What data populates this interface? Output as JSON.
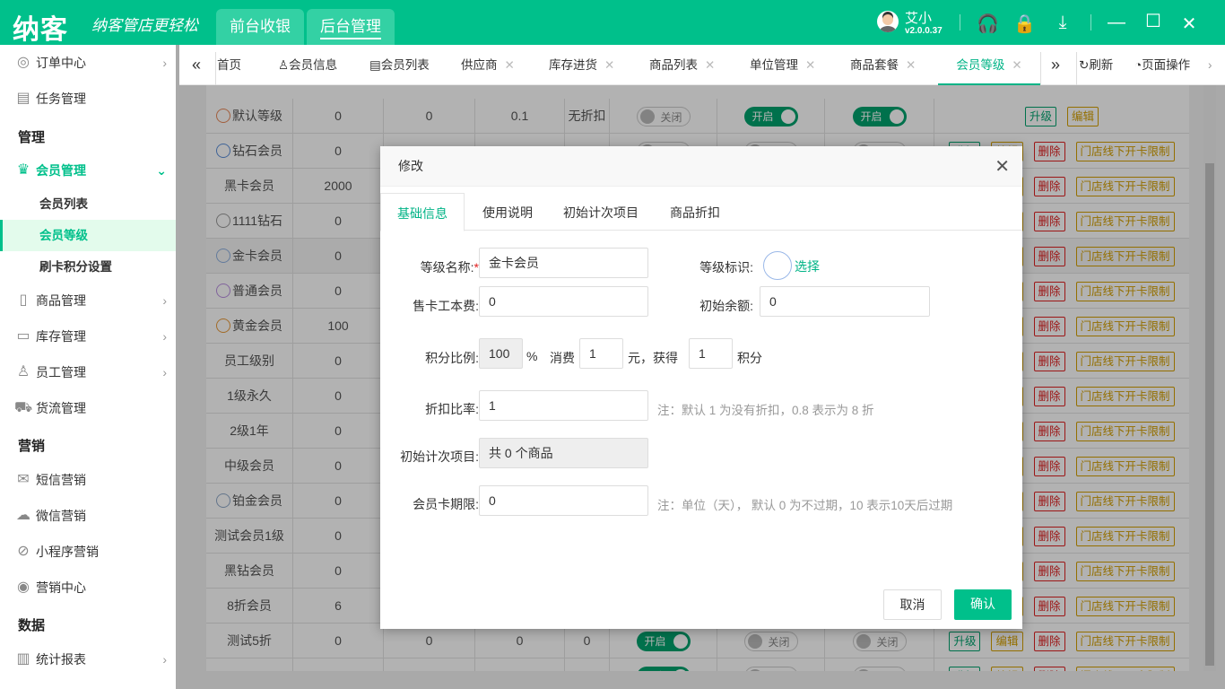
{
  "header": {
    "logo": "纳客",
    "slogan": "纳客管店更轻松",
    "tabs": [
      "前台收银",
      "后台管理"
    ],
    "active_tab": 1,
    "user_name": "艾小",
    "version": "v2.0.0.37"
  },
  "sidebar": {
    "items": [
      {
        "label": "订单中心",
        "icon": "globe-icon",
        "arrow": true
      },
      {
        "label": "任务管理",
        "icon": "task-icon"
      }
    ],
    "group_manage": "管理",
    "member_mgmt": {
      "label": "会员管理",
      "icon": "crown-icon"
    },
    "subitems": [
      "会员列表",
      "会员等级",
      "刷卡积分设置"
    ],
    "items2": [
      {
        "label": "商品管理",
        "icon": "goods-icon"
      },
      {
        "label": "库存管理",
        "icon": "inventory-icon"
      },
      {
        "label": "员工管理",
        "icon": "user-icon"
      },
      {
        "label": "货流管理",
        "icon": "truck-icon"
      }
    ],
    "group_marketing": "营销",
    "items3": [
      {
        "label": "短信营销",
        "icon": "mail-icon"
      },
      {
        "label": "微信营销",
        "icon": "wechat-icon"
      },
      {
        "label": "小程序营销",
        "icon": "miniprogram-icon"
      },
      {
        "label": "营销中心",
        "icon": "target-icon"
      }
    ],
    "group_data": "数据",
    "items4": [
      {
        "label": "统计报表",
        "icon": "chart-icon"
      }
    ]
  },
  "tabbar": {
    "tabs": [
      "首页",
      "会员信息",
      "会员列表",
      "供应商",
      "库存进货",
      "商品列表",
      "单位管理",
      "商品套餐",
      "会员等级"
    ],
    "active": 8,
    "refresh": "刷新",
    "page_ops": "页面操作"
  },
  "table": {
    "on": "开启",
    "off": "关闭",
    "actions": {
      "upgrade": "升级",
      "edit": "编辑",
      "delete": "删除",
      "limit": "门店线下开卡限制"
    },
    "rows": [
      {
        "name": "默认等级",
        "badge": "#e8895a",
        "c": [
          "0",
          "0",
          "0.1",
          "无折扣"
        ],
        "t": [
          0,
          1,
          1
        ],
        "full": false
      },
      {
        "name": "钻石会员",
        "badge": "#5b8fd9",
        "c": [
          "0",
          "",
          "",
          ""
        ],
        "t": [
          0,
          0,
          0
        ],
        "full": true
      },
      {
        "name": "黑卡会员",
        "c": [
          "2000",
          "",
          "",
          ""
        ],
        "full": true
      },
      {
        "name": "1111钻石",
        "badge": "#999",
        "c": [
          "0",
          "",
          "",
          ""
        ],
        "full": true
      },
      {
        "name": "金卡会员",
        "badge": "#8fb0e0",
        "c": [
          "0",
          "",
          "",
          ""
        ],
        "full": true,
        "hl": true
      },
      {
        "name": "普通会员",
        "badge": "#b98fe0",
        "c": [
          "0",
          "",
          "",
          ""
        ],
        "full": true
      },
      {
        "name": "黄金会员",
        "badge": "#e89a3a",
        "c": [
          "100",
          "",
          "",
          ""
        ],
        "full": true
      },
      {
        "name": "员工级别",
        "c": [
          "0",
          "",
          "",
          ""
        ],
        "full": true
      },
      {
        "name": "1级永久",
        "c": [
          "0",
          "",
          "",
          ""
        ],
        "full": true
      },
      {
        "name": "2级1年",
        "c": [
          "0",
          "",
          "",
          ""
        ],
        "full": true
      },
      {
        "name": "中级会员",
        "c": [
          "0",
          "",
          "",
          ""
        ],
        "full": true
      },
      {
        "name": "铂金会员",
        "badge": "#8fa8c8",
        "c": [
          "0",
          "",
          "",
          ""
        ],
        "full": true
      },
      {
        "name": "测试会员1级",
        "c": [
          "0",
          "",
          "",
          ""
        ],
        "full": true
      },
      {
        "name": "黑钻会员",
        "c": [
          "0",
          "",
          "",
          ""
        ],
        "full": true
      },
      {
        "name": "8折会员",
        "c": [
          "6",
          "",
          "",
          ""
        ],
        "full": true
      },
      {
        "name": "测试5折",
        "c": [
          "0",
          "0",
          "0",
          "0"
        ],
        "t": [
          1,
          0,
          0
        ],
        "full": true
      },
      {
        "name": "",
        "c": [
          "",
          "",
          "",
          ""
        ],
        "t": [
          1,
          0,
          0
        ],
        "full": true
      }
    ]
  },
  "modal": {
    "title": "修改",
    "tabs": [
      "基础信息",
      "使用说明",
      "初始计次项目",
      "商品折扣"
    ],
    "level_name_label": "等级名称:",
    "required": "*",
    "level_name": "金卡会员",
    "level_icon_label": "等级标识:",
    "choose": "选择",
    "card_fee_label": "售卡工本费:",
    "card_fee": "0",
    "init_balance_label": "初始余额:",
    "init_balance": "0",
    "points_label": "积分比例:",
    "points_ratio": "100",
    "percent": "%",
    "spend": "消费",
    "spend_value": "1",
    "yuan_get": "元，获得",
    "points_value": "1",
    "points_unit": "积分",
    "discount_label": "折扣比率:",
    "discount": "1",
    "discount_note": "注：默认 1 为没有折扣，0.8 表示为 8 折",
    "count_items_label": "初始计次项目:",
    "count_items": "共 0 个商品",
    "validity_label": "会员卡期限:",
    "validity": "0",
    "validity_note": "注：单位（天），  默认 0 为不过期，10 表示10天后过期",
    "cancel": "取消",
    "confirm": "确认"
  },
  "colors": {
    "brand": "#00c08b",
    "danger": "#e02020",
    "warn": "#d4a000"
  }
}
